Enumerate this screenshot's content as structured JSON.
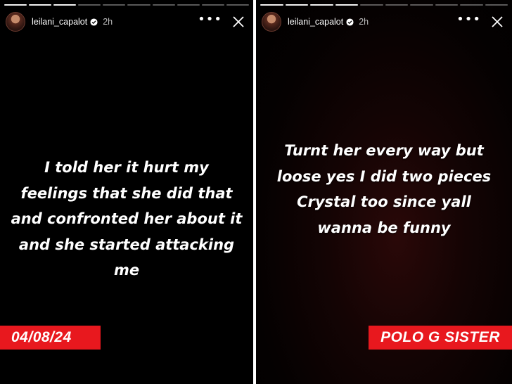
{
  "stories": [
    {
      "username": "leilani_capalot",
      "time": "2h",
      "caption": "I told her it hurt my feelings that she did that and confronted her about it and she started attacking me",
      "tag": "04/08/24"
    },
    {
      "username": "leilani_capalot",
      "time": "2h",
      "caption": "Turnt her every way but loose yes I did two pieces Crystal too since yall wanna be funny",
      "tag": "POLO G SISTER"
    }
  ],
  "icons": {
    "more": "more-options-icon",
    "close": "close-icon",
    "verified": "verified-badge-icon"
  },
  "colors": {
    "tag_red": "#e8181e",
    "background": "#000000",
    "text": "#ffffff"
  }
}
